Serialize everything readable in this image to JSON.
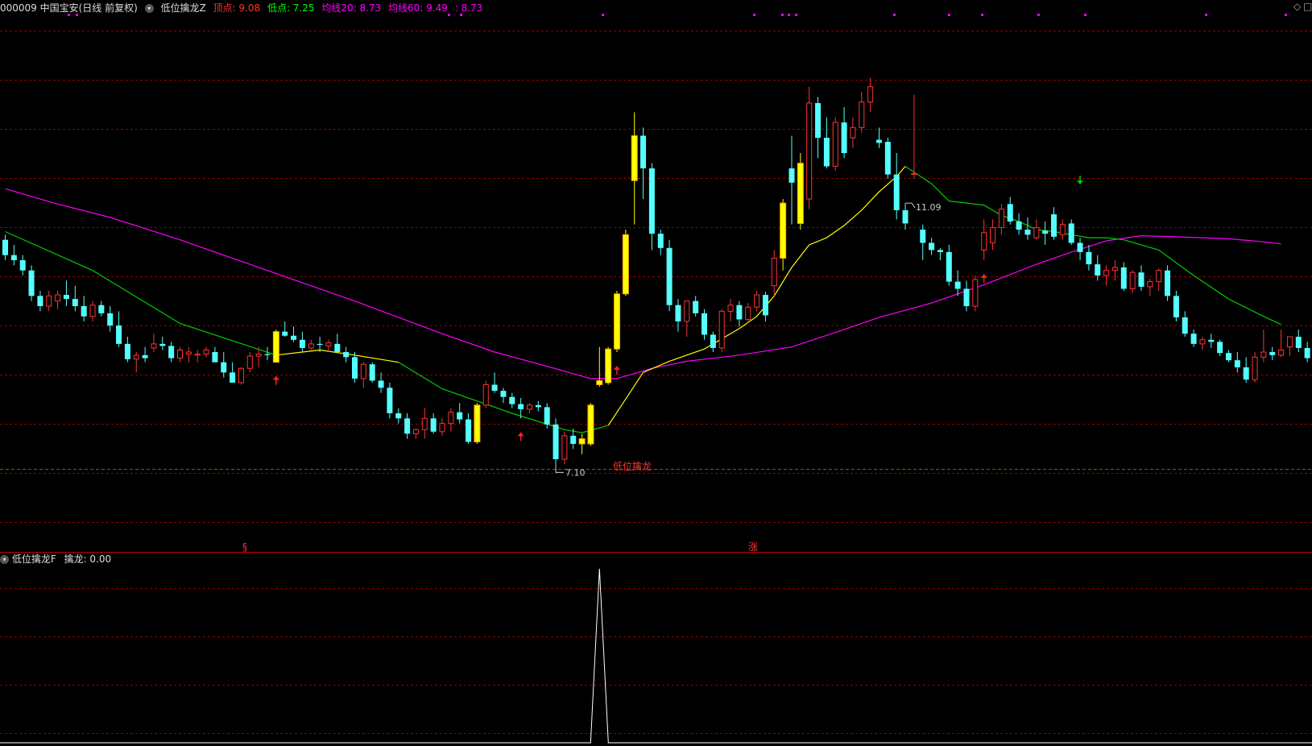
{
  "header": {
    "stock": "000009 中国宝安(日线 前复权)",
    "indicator": "低位擒龙Z",
    "top_label": "顶点: 9.08",
    "low_label": "低点: 7.25",
    "ma20_label": "均线20: 8.73",
    "ma60_label": "均线60: 9.49",
    "extra_label": ": 8.73"
  },
  "sub_header": {
    "indicator": "低位擒龙F",
    "value_label": "擒龙: 0.00"
  },
  "corner_icons": [
    "◇",
    "□"
  ],
  "colors": {
    "background": "#000000",
    "up": "#ff3232",
    "down": "#54ffff",
    "signal": "#ffff00",
    "signal_border": "#ffa500",
    "ma20": "#00cc00",
    "ma60": "#ff00ff",
    "ma_yellow": "#ffff00",
    "grid": "#990000",
    "support": "#00aa00",
    "panel_divider": "#cc0000"
  },
  "annotations": {
    "high_price": "11.09",
    "low_price": "7.10",
    "signal_text": "低位擒龙",
    "bottom_mark_1": "§",
    "bottom_mark_2": "涨"
  },
  "chart_data": {
    "type": "candlestick",
    "ylim": [
      6.45,
      11.55
    ],
    "support_level": 7.25,
    "ohlc": [
      [
        9.5,
        9.55,
        9.3,
        9.35
      ],
      [
        9.35,
        9.45,
        9.25,
        9.3
      ],
      [
        9.3,
        9.35,
        9.15,
        9.2
      ],
      [
        9.2,
        9.25,
        8.9,
        8.95
      ],
      [
        8.95,
        9.0,
        8.8,
        8.85
      ],
      [
        8.85,
        9.0,
        8.8,
        8.95
      ],
      [
        8.9,
        9.0,
        8.82,
        8.96
      ],
      [
        8.96,
        9.1,
        8.85,
        8.92
      ],
      [
        8.92,
        9.05,
        8.8,
        8.85
      ],
      [
        8.85,
        8.95,
        8.7,
        8.75
      ],
      [
        8.75,
        8.9,
        8.7,
        8.86
      ],
      [
        8.86,
        8.9,
        8.75,
        8.78
      ],
      [
        8.78,
        8.85,
        8.6,
        8.66
      ],
      [
        8.66,
        8.8,
        8.45,
        8.48
      ],
      [
        8.48,
        8.55,
        8.3,
        8.33
      ],
      [
        8.33,
        8.4,
        8.2,
        8.37
      ],
      [
        8.37,
        8.45,
        8.3,
        8.34
      ],
      [
        8.44,
        8.58,
        8.4,
        8.48
      ],
      [
        8.48,
        8.55,
        8.42,
        8.46
      ],
      [
        8.46,
        8.5,
        8.3,
        8.34
      ],
      [
        8.34,
        8.45,
        8.3,
        8.42
      ],
      [
        8.38,
        8.45,
        8.3,
        8.4
      ],
      [
        8.37,
        8.42,
        8.3,
        8.38
      ],
      [
        8.38,
        8.45,
        8.35,
        8.42
      ],
      [
        8.4,
        8.45,
        8.3,
        8.3
      ],
      [
        8.3,
        8.4,
        8.15,
        8.2
      ],
      [
        8.2,
        8.3,
        8.1,
        8.1
      ],
      [
        8.1,
        8.25,
        8.08,
        8.24
      ],
      [
        8.24,
        8.4,
        8.2,
        8.36
      ],
      [
        8.36,
        8.45,
        8.25,
        8.38
      ],
      [
        8.38,
        8.45,
        8.32,
        8.37
      ],
      [
        8.3,
        8.62,
        8.3,
        8.6
      ],
      [
        8.6,
        8.7,
        8.55,
        8.56
      ],
      [
        8.56,
        8.65,
        8.5,
        8.52
      ],
      [
        8.52,
        8.6,
        8.4,
        8.44
      ],
      [
        8.44,
        8.52,
        8.42,
        8.48
      ],
      [
        8.48,
        8.55,
        8.4,
        8.47
      ],
      [
        8.46,
        8.52,
        8.4,
        8.49
      ],
      [
        8.48,
        8.58,
        8.42,
        8.4
      ],
      [
        8.4,
        8.45,
        8.3,
        8.35
      ],
      [
        8.35,
        8.4,
        8.1,
        8.14
      ],
      [
        8.14,
        8.3,
        8.05,
        8.28
      ],
      [
        8.28,
        8.3,
        8.1,
        8.12
      ],
      [
        8.12,
        8.2,
        8.0,
        8.05
      ],
      [
        8.05,
        8.1,
        7.75,
        7.8
      ],
      [
        7.8,
        7.85,
        7.7,
        7.75
      ],
      [
        7.75,
        7.8,
        7.55,
        7.6
      ],
      [
        7.6,
        7.65,
        7.55,
        7.64
      ],
      [
        7.64,
        7.85,
        7.55,
        7.75
      ],
      [
        7.75,
        7.8,
        7.6,
        7.62
      ],
      [
        7.62,
        7.75,
        7.58,
        7.7
      ],
      [
        7.7,
        7.85,
        7.62,
        7.81
      ],
      [
        7.81,
        7.9,
        7.7,
        7.74
      ],
      [
        7.74,
        7.8,
        7.5,
        7.52
      ],
      [
        7.52,
        7.9,
        7.5,
        7.88
      ],
      [
        7.88,
        8.12,
        7.85,
        8.08
      ],
      [
        8.08,
        8.2,
        8.0,
        8.02
      ],
      [
        8.02,
        8.05,
        7.9,
        7.96
      ],
      [
        7.96,
        8.0,
        7.85,
        7.89
      ],
      [
        7.89,
        7.95,
        7.75,
        7.84
      ],
      [
        7.84,
        7.9,
        7.8,
        7.88
      ],
      [
        7.88,
        7.92,
        7.82,
        7.86
      ],
      [
        7.86,
        7.9,
        7.65,
        7.69
      ],
      [
        7.69,
        7.75,
        7.3,
        7.35
      ],
      [
        7.35,
        7.62,
        7.3,
        7.58
      ],
      [
        7.58,
        7.65,
        7.45,
        7.5
      ],
      [
        7.5,
        7.6,
        7.4,
        7.55
      ],
      [
        7.5,
        7.9,
        7.48,
        7.88
      ],
      [
        8.08,
        8.45,
        8.06,
        8.12
      ],
      [
        8.1,
        8.45,
        8.08,
        8.43
      ],
      [
        8.43,
        9.0,
        8.4,
        8.97
      ],
      [
        8.97,
        9.6,
        8.95,
        9.55
      ],
      [
        10.08,
        10.75,
        9.65,
        10.52
      ],
      [
        10.52,
        10.6,
        9.9,
        10.2
      ],
      [
        10.2,
        10.25,
        9.4,
        9.56
      ],
      [
        9.56,
        9.6,
        9.35,
        9.42
      ],
      [
        9.42,
        9.5,
        8.8,
        8.86
      ],
      [
        8.86,
        8.92,
        8.6,
        8.7
      ],
      [
        8.7,
        8.9,
        8.55,
        8.9
      ],
      [
        8.9,
        8.95,
        8.75,
        8.78
      ],
      [
        8.78,
        8.82,
        8.52,
        8.57
      ],
      [
        8.57,
        8.6,
        8.4,
        8.44
      ],
      [
        8.44,
        8.82,
        8.4,
        8.8
      ],
      [
        8.8,
        8.92,
        8.7,
        8.86
      ],
      [
        8.86,
        8.9,
        8.65,
        8.72
      ],
      [
        8.72,
        8.88,
        8.68,
        8.84
      ],
      [
        8.84,
        9.0,
        8.8,
        8.96
      ],
      [
        8.96,
        8.99,
        8.7,
        8.76
      ],
      [
        9.05,
        9.4,
        8.95,
        9.32
      ],
      [
        9.32,
        9.9,
        9.2,
        9.86
      ],
      [
        10.2,
        10.52,
        9.65,
        10.06
      ],
      [
        10.25,
        10.35,
        9.6,
        9.66
      ],
      [
        9.9,
        11.0,
        9.8,
        10.84
      ],
      [
        10.84,
        10.9,
        10.3,
        10.5
      ],
      [
        10.5,
        10.7,
        10.2,
        10.22
      ],
      [
        10.22,
        10.7,
        10.18,
        10.65
      ],
      [
        10.65,
        10.8,
        10.3,
        10.35
      ],
      [
        10.5,
        10.7,
        10.4,
        10.6
      ],
      [
        10.6,
        10.95,
        10.55,
        10.85
      ],
      [
        10.85,
        11.09,
        10.75,
        11.0
      ],
      [
        10.48,
        10.6,
        10.4,
        10.45
      ],
      [
        10.46,
        10.5,
        10.1,
        10.14
      ],
      [
        10.14,
        10.35,
        9.7,
        9.79
      ],
      [
        9.79,
        9.86,
        9.6,
        9.66
      ],
      [
        10.14,
        10.92,
        10.1,
        10.15
      ],
      [
        9.6,
        9.65,
        9.3,
        9.47
      ],
      [
        9.47,
        9.52,
        9.35,
        9.4
      ],
      [
        9.4,
        9.42,
        9.3,
        9.38
      ],
      [
        9.38,
        9.45,
        9.05,
        9.09
      ],
      [
        9.09,
        9.2,
        8.95,
        9.02
      ],
      [
        9.02,
        9.1,
        8.8,
        8.85
      ],
      [
        8.85,
        9.15,
        8.8,
        9.11
      ],
      [
        9.4,
        9.7,
        9.3,
        9.57
      ],
      [
        9.47,
        9.7,
        9.4,
        9.62
      ],
      [
        9.62,
        9.85,
        9.55,
        9.8
      ],
      [
        9.85,
        9.92,
        9.65,
        9.68
      ],
      [
        9.68,
        9.76,
        9.55,
        9.6
      ],
      [
        9.6,
        9.72,
        9.5,
        9.55
      ],
      [
        9.52,
        9.7,
        9.5,
        9.62
      ],
      [
        9.59,
        9.68,
        9.45,
        9.56
      ],
      [
        9.75,
        9.82,
        9.5,
        9.53
      ],
      [
        9.55,
        9.7,
        9.5,
        9.65
      ],
      [
        9.66,
        9.7,
        9.45,
        9.47
      ],
      [
        9.47,
        9.52,
        9.3,
        9.38
      ],
      [
        9.38,
        9.45,
        9.2,
        9.26
      ],
      [
        9.26,
        9.35,
        9.1,
        9.15
      ],
      [
        9.15,
        9.25,
        9.05,
        9.2
      ],
      [
        9.2,
        9.3,
        9.1,
        9.23
      ],
      [
        9.23,
        9.28,
        9.0,
        9.02
      ],
      [
        9.02,
        9.2,
        8.98,
        9.18
      ],
      [
        9.18,
        9.25,
        9.0,
        9.04
      ],
      [
        9.04,
        9.12,
        8.95,
        9.09
      ],
      [
        9.09,
        9.22,
        9.0,
        9.2
      ],
      [
        9.2,
        9.25,
        8.9,
        8.95
      ],
      [
        8.95,
        9.0,
        8.7,
        8.74
      ],
      [
        8.74,
        8.8,
        8.55,
        8.58
      ],
      [
        8.58,
        8.62,
        8.45,
        8.48
      ],
      [
        8.48,
        8.55,
        8.42,
        8.52
      ],
      [
        8.52,
        8.58,
        8.44,
        8.5
      ],
      [
        8.5,
        8.52,
        8.36,
        8.39
      ],
      [
        8.39,
        8.42,
        8.3,
        8.32
      ],
      [
        8.32,
        8.4,
        8.2,
        8.25
      ],
      [
        8.25,
        8.35,
        8.1,
        8.13
      ],
      [
        8.13,
        8.4,
        8.1,
        8.35
      ],
      [
        8.35,
        8.62,
        8.3,
        8.4
      ],
      [
        8.4,
        8.45,
        8.32,
        8.37
      ],
      [
        8.37,
        8.62,
        8.35,
        8.42
      ],
      [
        8.45,
        8.55,
        8.36,
        8.55
      ],
      [
        8.55,
        8.62,
        8.4,
        8.44
      ],
      [
        8.44,
        8.5,
        8.3,
        8.34
      ],
      [
        8.34,
        8.45,
        8.28,
        8.4
      ]
    ],
    "signal_candles": [
      31,
      54,
      66,
      67,
      68,
      69,
      70,
      71,
      72,
      89,
      91
    ],
    "up_arrows": [
      31,
      59,
      70,
      112
    ],
    "down_arrows": [
      123
    ],
    "ma20": [
      [
        0,
        9.58
      ],
      [
        10,
        9.2
      ],
      [
        20,
        8.68
      ],
      [
        31,
        8.37
      ],
      [
        36,
        8.42
      ],
      [
        40,
        8.37
      ],
      [
        45,
        8.3
      ],
      [
        50,
        8.04
      ],
      [
        58,
        7.8
      ],
      [
        64,
        7.64
      ],
      [
        66,
        7.61
      ],
      [
        69,
        7.68
      ],
      [
        71,
        7.94
      ],
      [
        73,
        8.2
      ],
      [
        76,
        8.31
      ],
      [
        80,
        8.43
      ],
      [
        84,
        8.63
      ],
      [
        86,
        8.75
      ],
      [
        88,
        8.95
      ],
      [
        90,
        9.23
      ],
      [
        92,
        9.45
      ],
      [
        94,
        9.52
      ],
      [
        96,
        9.64
      ],
      [
        98,
        9.79
      ],
      [
        100,
        9.97
      ],
      [
        102,
        10.12
      ],
      [
        103,
        10.22
      ],
      [
        106,
        10.05
      ],
      [
        108,
        9.88
      ],
      [
        112,
        9.84
      ],
      [
        114,
        9.74
      ],
      [
        116,
        9.68
      ],
      [
        118,
        9.6
      ],
      [
        120,
        9.58
      ],
      [
        122,
        9.55
      ],
      [
        124,
        9.52
      ],
      [
        126,
        9.52
      ],
      [
        128,
        9.5
      ],
      [
        132,
        9.4
      ],
      [
        136,
        9.15
      ],
      [
        140,
        8.92
      ],
      [
        144,
        8.75
      ],
      [
        146,
        8.67
      ]
    ],
    "ma60": [
      [
        0,
        10.0
      ],
      [
        6,
        9.85
      ],
      [
        12,
        9.72
      ],
      [
        20,
        9.5
      ],
      [
        30,
        9.2
      ],
      [
        40,
        8.9
      ],
      [
        50,
        8.58
      ],
      [
        56,
        8.4
      ],
      [
        62,
        8.26
      ],
      [
        67,
        8.14
      ],
      [
        70,
        8.14
      ],
      [
        74,
        8.24
      ],
      [
        78,
        8.31
      ],
      [
        84,
        8.37
      ],
      [
        90,
        8.45
      ],
      [
        96,
        8.62
      ],
      [
        100,
        8.74
      ],
      [
        106,
        8.88
      ],
      [
        112,
        9.06
      ],
      [
        118,
        9.26
      ],
      [
        122,
        9.38
      ],
      [
        126,
        9.49
      ],
      [
        130,
        9.54
      ],
      [
        134,
        9.53
      ],
      [
        140,
        9.51
      ],
      [
        144,
        9.48
      ],
      [
        146,
        9.46
      ]
    ],
    "indicator_spike": {
      "index": 68,
      "value": 1
    }
  }
}
